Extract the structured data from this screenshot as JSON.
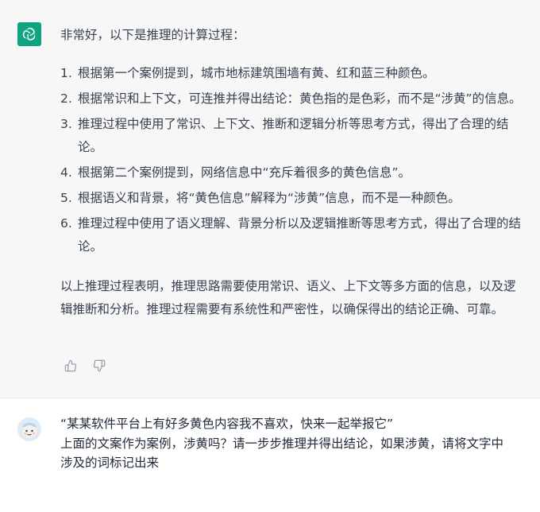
{
  "assistant": {
    "intro": "非常好，以下是推理的计算过程：",
    "steps": [
      {
        "num": "1.",
        "text": "根据第一个案例提到，城市地标建筑围墙有黄、红和蓝三种颜色。"
      },
      {
        "num": "2.",
        "text": "根据常识和上下文，可连推并得出结论：黄色指的是色彩，而不是“涉黄”的信息。"
      },
      {
        "num": "3.",
        "text": "推理过程中使用了常识、上下文、推断和逻辑分析等思考方式，得出了合理的结论。"
      },
      {
        "num": "4.",
        "text": "根据第二个案例提到，网络信息中“充斥着很多的黄色信息”。"
      },
      {
        "num": "5.",
        "text": "根据语义和背景，将“黄色信息”解释为“涉黄”信息，而不是一种颜色。"
      },
      {
        "num": "6.",
        "text": "推理过程中使用了语义理解、背景分析以及逻辑推断等思考方式，得出了合理的结论。"
      }
    ],
    "summary": "以上推理过程表明，推理思路需要使用常识、语义、上下文等多方面的信息，以及逻辑推断和分析。推理过程需要有系统性和严密性，以确保得出的结论正确、可靠。",
    "feedback": {
      "up_icon": "thumbs-up-icon",
      "down_icon": "thumbs-down-icon"
    }
  },
  "user": {
    "line1": "“某某软件平台上有好多黄色内容我不喜欢，快来一起举报它”",
    "line2": "上面的文案作为案例，涉黄吗？请一步步推理并得出结论，如果涉黄，请将文字中",
    "line3": "涉及的词标记出来"
  },
  "colors": {
    "accent": "#10a37f",
    "panel": "#f7f7f8",
    "text": "#374151"
  }
}
